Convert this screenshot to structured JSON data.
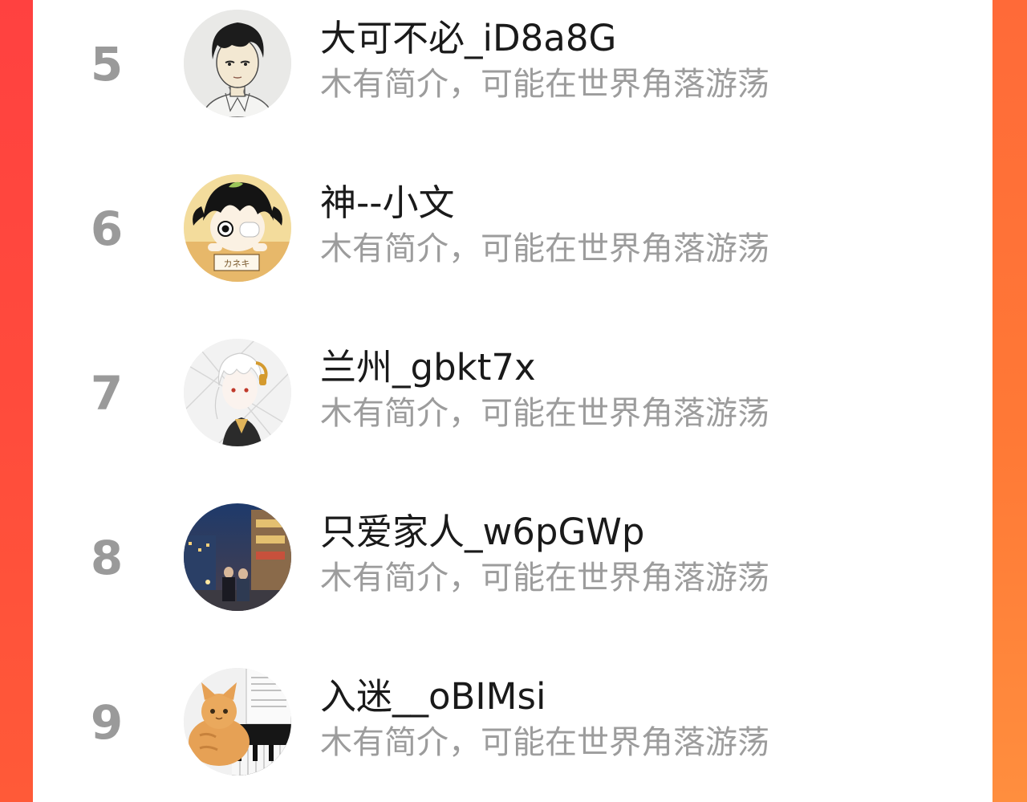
{
  "ranking": {
    "rows": [
      {
        "rank": "5",
        "name": "大可不必_iD8a8G",
        "bio": "木有简介，可能在世界角落游荡",
        "avatar": "sketched-boy-avatar"
      },
      {
        "rank": "6",
        "name": "神--小文",
        "bio": "木有简介，可能在世界角落游荡",
        "avatar": "anime-boy-in-box-avatar"
      },
      {
        "rank": "7",
        "name": "兰州_gbkt7x",
        "bio": "木有简介，可能在世界角落游荡",
        "avatar": "white-hair-anime-avatar"
      },
      {
        "rank": "8",
        "name": "只爱家人_w6pGWp",
        "bio": "木有简介，可能在世界角落游荡",
        "avatar": "night-street-photo-avatar"
      },
      {
        "rank": "9",
        "name": "入迷__oBIMsi",
        "bio": "木有简介，可能在世界角落游荡",
        "avatar": "orange-cat-piano-avatar"
      }
    ]
  },
  "colors": {
    "frame": "#ff5a3a",
    "rank_number": "#9a9a9a",
    "name": "#1a1a1a",
    "bio": "#9c9c9c"
  }
}
